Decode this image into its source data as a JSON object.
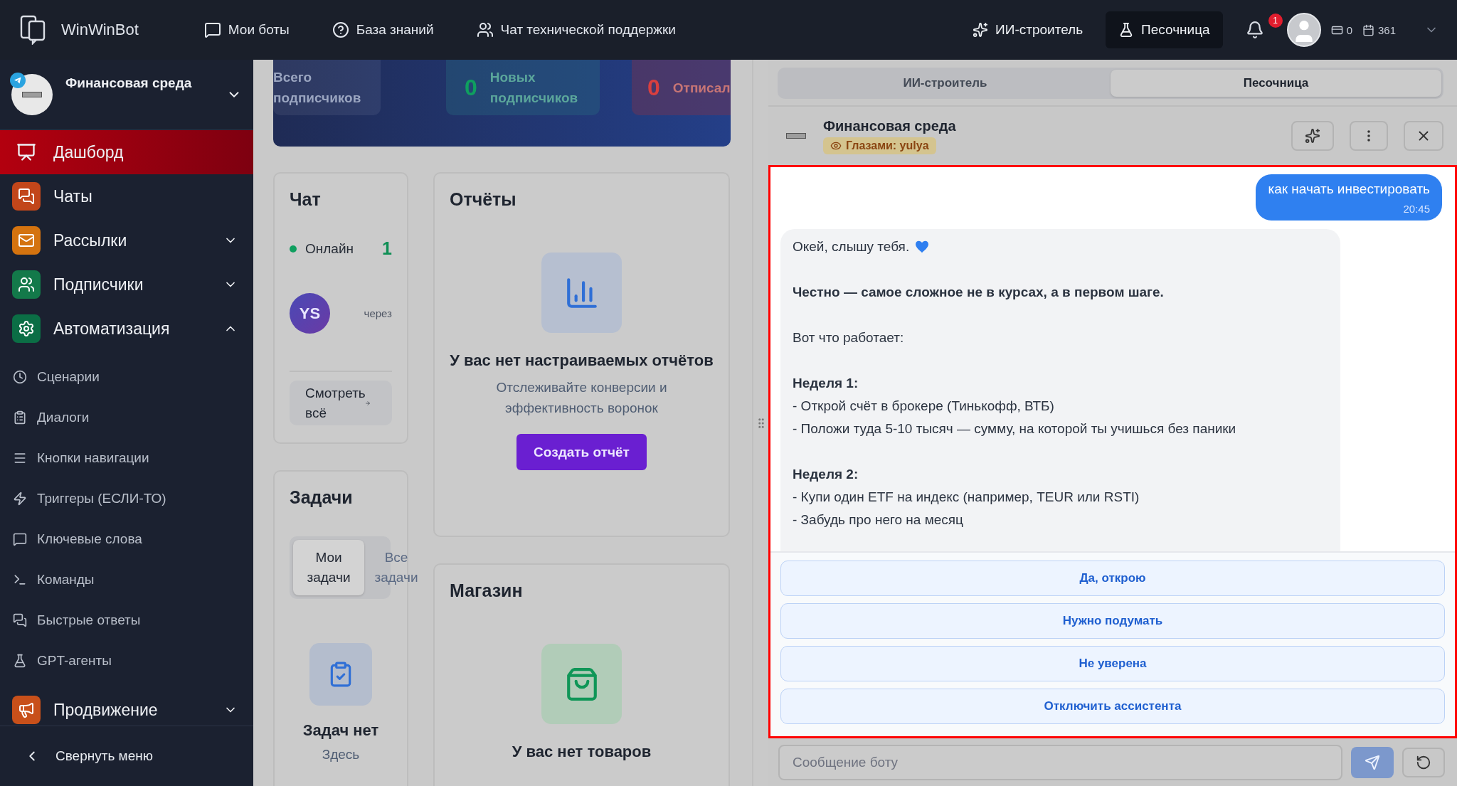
{
  "topbar": {
    "brand": "WinWinBot",
    "nav": [
      "Мои боты",
      "База знаний",
      "Чат технической поддержки"
    ],
    "modes": [
      {
        "label": "ИИ-строитель",
        "selected": false
      },
      {
        "label": "Песочница",
        "selected": true
      }
    ],
    "notification_count": "1",
    "counters": [
      "0",
      "361"
    ]
  },
  "sidebar": {
    "bot_name": "Финансовая среда",
    "items": [
      {
        "label": "Дашборд",
        "kind": "link",
        "selected": true
      },
      {
        "label": "Чаты",
        "kind": "link",
        "selected": false,
        "color": "#c2461a"
      },
      {
        "label": "Рассылки",
        "kind": "group",
        "selected": false,
        "expanded": false,
        "color": "#d4730f"
      },
      {
        "label": "Подписчики",
        "kind": "group",
        "selected": false,
        "expanded": false,
        "color": "#13794a"
      },
      {
        "label": "Автоматизация",
        "kind": "group",
        "selected": false,
        "expanded": true,
        "color": "#0b6e45",
        "children": [
          {
            "label": "Сценарии"
          },
          {
            "label": "Диалоги"
          },
          {
            "label": "Кнопки навигации"
          },
          {
            "label": "Триггеры (ЕСЛИ-ТО)"
          },
          {
            "label": "Ключевые слова"
          },
          {
            "label": "Команды"
          },
          {
            "label": "Быстрые ответы"
          },
          {
            "label": "GPT-агенты"
          }
        ]
      },
      {
        "label": "Продвижение",
        "kind": "group",
        "selected": false,
        "expanded": false,
        "color": "#c8501a"
      }
    ],
    "collapse": "Свернуть меню"
  },
  "dashboard": {
    "stats": [
      {
        "label": "Всего подписчиков"
      },
      {
        "value": "0",
        "label": "Новых подписчиков",
        "color": "#0f9f5f"
      },
      {
        "value": "0",
        "label": "Отписал",
        "color": "#d93f3f"
      }
    ],
    "chat": {
      "title": "Чат",
      "online_label": "Онлайн",
      "online_count": "1",
      "avatar": "YS",
      "via": "через",
      "view_all": "Смотреть всё"
    },
    "tasks": {
      "title": "Задачи",
      "tabs": [
        {
          "label": "Мои задачи",
          "selected": true
        },
        {
          "label": "Все задачи",
          "selected": false
        }
      ],
      "empty_title": "Задач нет",
      "empty_text": "Здесь"
    },
    "reports": {
      "title": "Отчёты",
      "empty_title": "У вас нет настраиваемых отчётов",
      "empty_text": "Отслеживайте конверсии и эффективность воронок",
      "button": "Создать отчёт"
    },
    "shop": {
      "title": "Магазин",
      "empty_title": "У вас нет товаров"
    }
  },
  "panel": {
    "tabs": [
      {
        "label": "ИИ-строитель",
        "selected": false
      },
      {
        "label": "Песочница",
        "selected": true
      }
    ],
    "bot_name": "Финансовая среда",
    "viewer_badge": "Глазами: yulya",
    "messages": [
      {
        "kind": "user",
        "text": "как начать инвестировать",
        "time": "20:45"
      },
      {
        "kind": "bot",
        "paragraphs": [
          [
            {
              "text": "Окей, слышу тебя.",
              "bold": false,
              "heart": true
            }
          ],
          [
            {
              "text": "Честно — самое сложное не в курсах, а в первом шаге.",
              "bold": true
            }
          ],
          [
            {
              "text": "Вот что работает:",
              "bold": false
            }
          ],
          [
            {
              "text": "Неделя 1:",
              "bold": true
            },
            {
              "text": "- Открой счёт в брокере (Тинькофф, ВТБ)",
              "bold": false
            },
            {
              "text": "- Положи туда 5-10 тысяч — сумму, на которой ты учишься без паники",
              "bold": false
            }
          ],
          [
            {
              "text": "Неделя 2:",
              "bold": true
            },
            {
              "text": "- Купи один ETF на индекс (например, TEUR или RSTI)",
              "bold": false
            },
            {
              "text": "- Забудь про него на месяц",
              "bold": false
            }
          ]
        ]
      }
    ],
    "quick_replies": [
      "Да, открою",
      "Нужно подумать",
      "Не уверена",
      "Отключить ассистента"
    ],
    "input": {
      "placeholder": "Сообщение боту"
    }
  }
}
